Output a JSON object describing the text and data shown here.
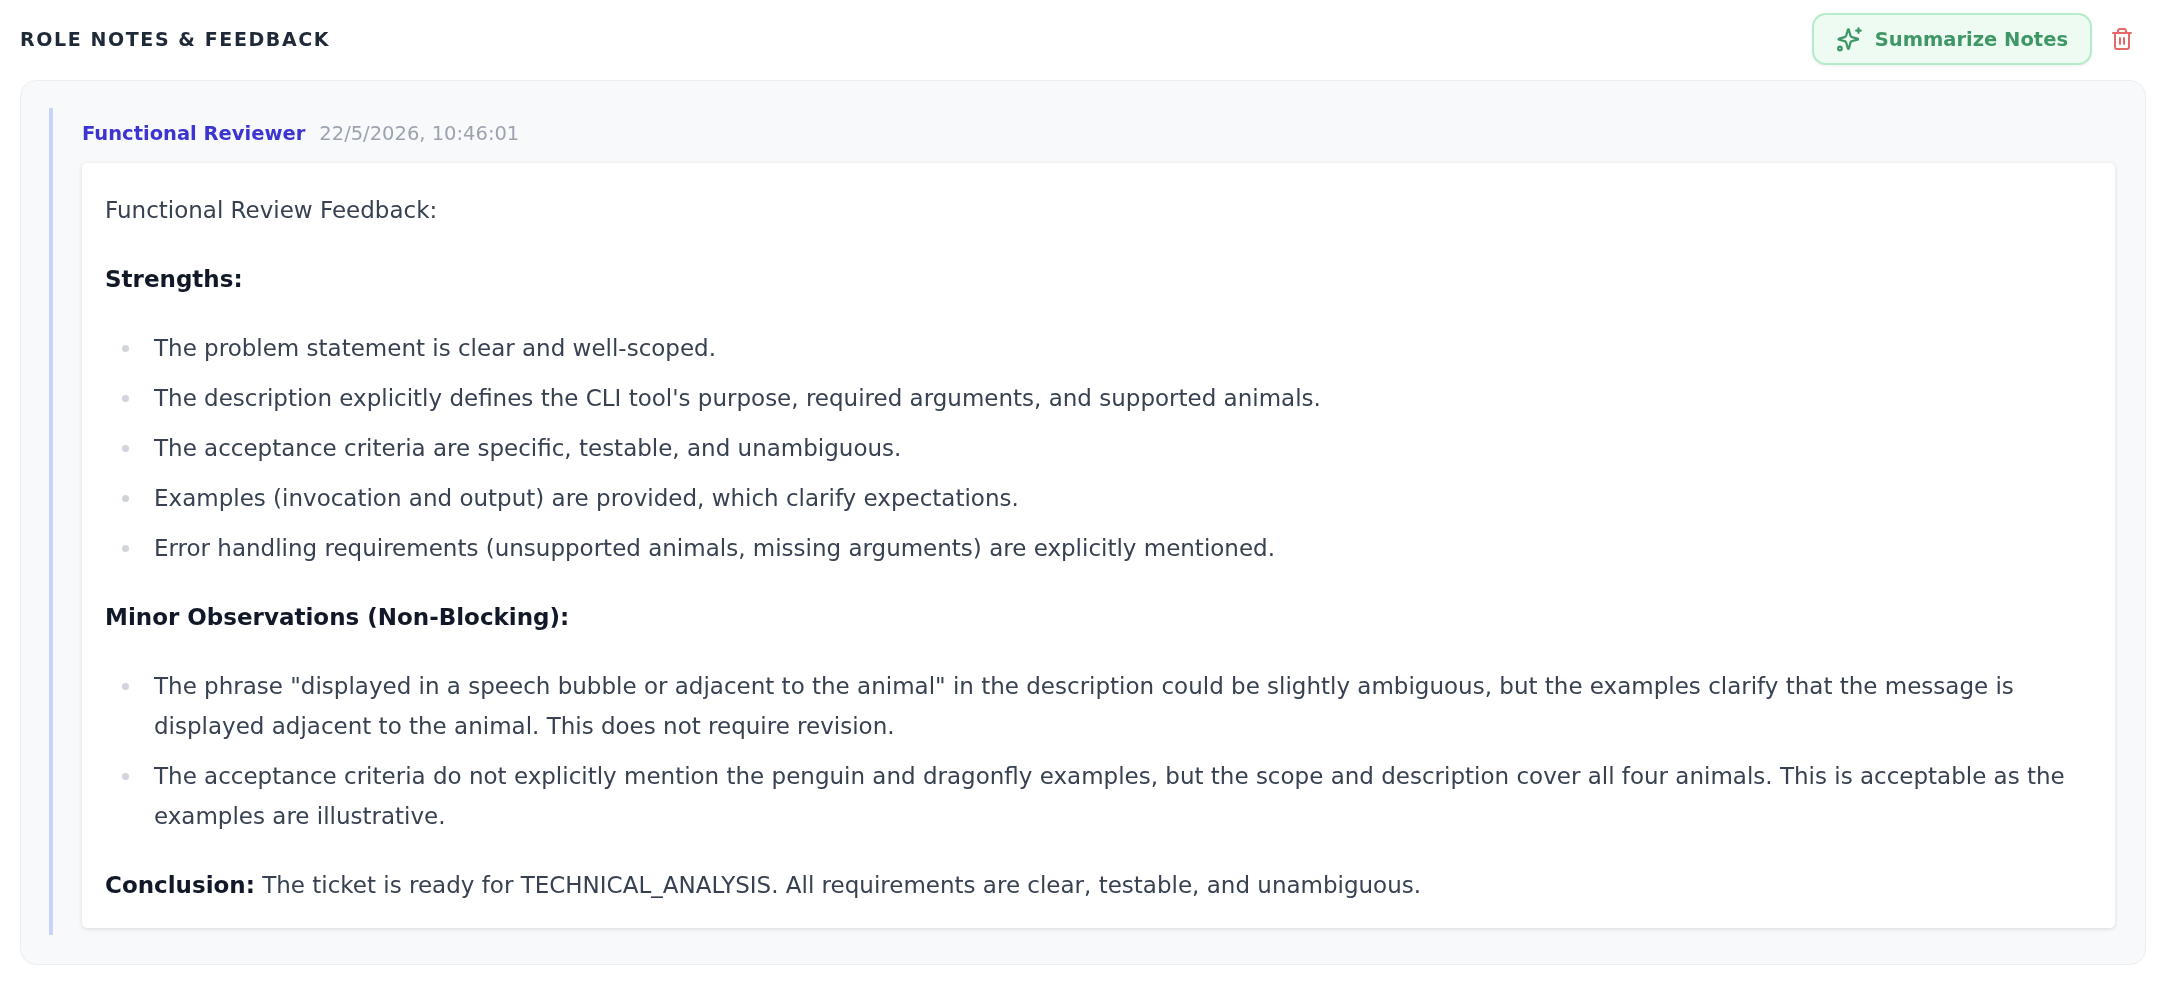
{
  "header": {
    "title": "ROLE NOTES & FEEDBACK",
    "summarize_button": {
      "label": "Summarize Notes"
    }
  },
  "notes": [
    {
      "author": "Functional Reviewer",
      "timestamp": "22/5/2026, 10:46:01",
      "body": [
        {
          "kind": "paragraph",
          "text": "Functional Review Feedback:"
        },
        {
          "kind": "heading",
          "text": "Strengths:"
        },
        {
          "kind": "list",
          "items": [
            "The problem statement is clear and well-scoped.",
            "The description explicitly defines the CLI tool's purpose, required arguments, and supported animals.",
            "The acceptance criteria are specific, testable, and unambiguous.",
            "Examples (invocation and output) are provided, which clarify expectations.",
            "Error handling requirements (unsupported animals, missing arguments) are explicitly mentioned."
          ]
        },
        {
          "kind": "heading",
          "text": "Minor Observations (Non-Blocking):"
        },
        {
          "kind": "list",
          "items": [
            "The phrase \"displayed in a speech bubble or adjacent to the animal\" in the description could be slightly ambiguous, but the examples clarify that the message is displayed adjacent to the animal. This does not require revision.",
            "The acceptance criteria do not explicitly mention the penguin and dragonfly examples, but the scope and description cover all four animals. This is acceptable as the examples are illustrative."
          ]
        },
        {
          "kind": "paragraph",
          "text": "**Conclusion:** The ticket is ready for TECHNICAL_ANALYSIS. All requirements are clear, testable, and unambiguous."
        }
      ]
    }
  ]
}
